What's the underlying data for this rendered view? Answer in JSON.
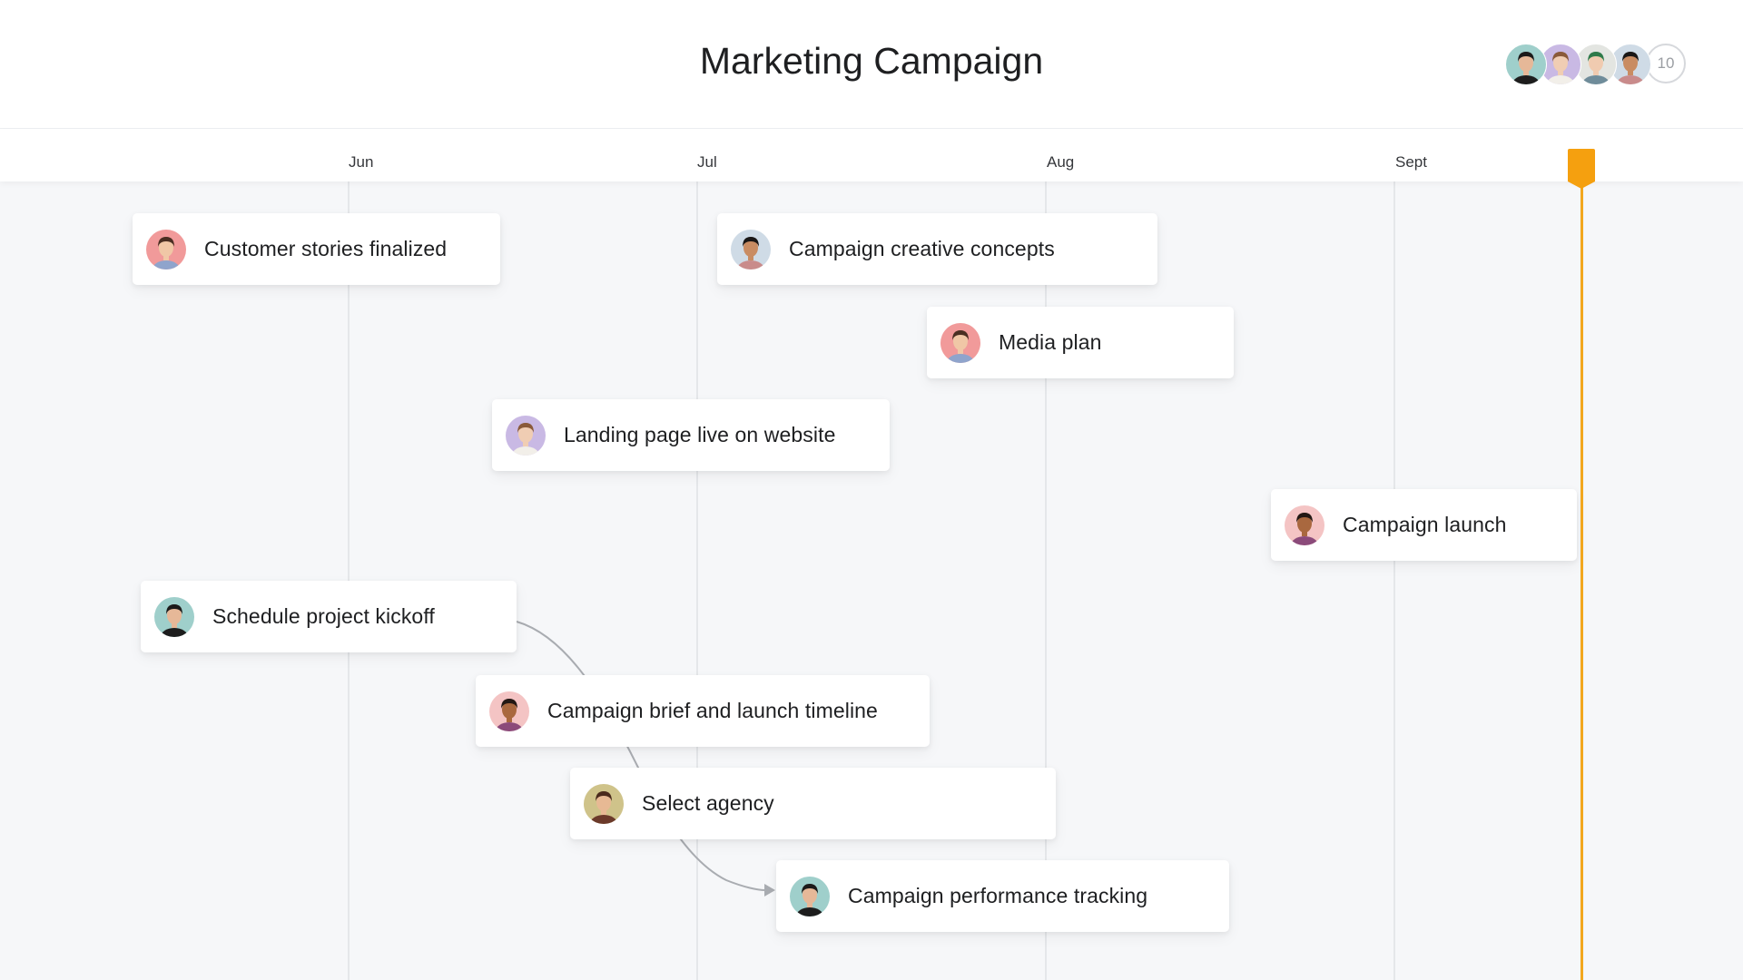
{
  "project": {
    "title": "Marketing Campaign"
  },
  "members": {
    "avatars": [
      {
        "name": "member-1",
        "bg": "#9fcfcb",
        "skin": "#e6b898",
        "hair": "#1c1a1a",
        "shirt": "#1d1d1d"
      },
      {
        "name": "member-2",
        "bg": "#c9b9e4",
        "skin": "#f0cdb3",
        "hair": "#8a5a3a",
        "shirt": "#f2efe9"
      },
      {
        "name": "member-3",
        "bg": "#e3e5e1",
        "skin": "#f0cbb0",
        "hair": "#2f7a4a",
        "shirt": "#6f8c9a"
      },
      {
        "name": "member-4",
        "bg": "#cfdbe6",
        "skin": "#c98c62",
        "hair": "#1a1716",
        "shirt": "#c98b8b"
      }
    ],
    "overflow_count": "10"
  },
  "timeline": {
    "months": [
      "Jun",
      "Jul",
      "Aug",
      "Sept"
    ],
    "today_color": "#f2a71e"
  },
  "milestones": [
    {
      "label": "Customer stories finalized",
      "avatar": {
        "bg": "#f19a9a",
        "skin": "#f0c7a6",
        "hair": "#4a2e22",
        "shirt": "#8fa4cc"
      }
    },
    {
      "label": "Campaign creative concepts",
      "avatar": {
        "bg": "#cfdbe6",
        "skin": "#c98c62",
        "hair": "#1a1716",
        "shirt": "#c98b8b"
      }
    },
    {
      "label": "Media plan",
      "avatar": {
        "bg": "#f19a9a",
        "skin": "#f0c7a6",
        "hair": "#4a2e22",
        "shirt": "#8fa4cc"
      }
    },
    {
      "label": "Landing page live on website",
      "avatar": {
        "bg": "#c9b9e4",
        "skin": "#f0cdb3",
        "hair": "#8a5a3a",
        "shirt": "#f2efe9"
      }
    },
    {
      "label": "Campaign launch",
      "avatar": {
        "bg": "#f4c4c4",
        "skin": "#a9683f",
        "hair": "#231814",
        "shirt": "#8b4a7a"
      }
    },
    {
      "label": "Schedule project kickoff",
      "avatar": {
        "bg": "#9fcfcb",
        "skin": "#e6b898",
        "hair": "#1c1a1a",
        "shirt": "#1d1d1d"
      }
    },
    {
      "label": "Campaign brief and launch timeline",
      "avatar": {
        "bg": "#f4c4c4",
        "skin": "#a9683f",
        "hair": "#231814",
        "shirt": "#8b4a7a"
      }
    },
    {
      "label": "Select agency",
      "avatar": {
        "bg": "#cfc38a",
        "skin": "#e7b994",
        "hair": "#4a2a1c",
        "shirt": "#6b3a2a"
      }
    },
    {
      "label": "Campaign performance tracking",
      "avatar": {
        "bg": "#9fcfcb",
        "skin": "#e6b898",
        "hair": "#1c1a1a",
        "shirt": "#1d1d1d"
      }
    }
  ]
}
